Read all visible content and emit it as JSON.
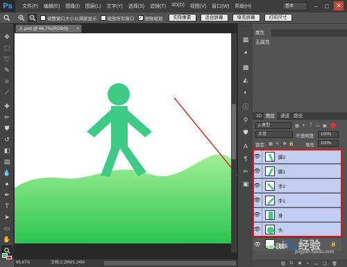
{
  "app": {
    "logo": "Ps"
  },
  "menu": [
    "文件(F)",
    "编辑(E)",
    "图像(I)",
    "图层(L)",
    "文字(Y)",
    "选择(S)",
    "滤镜(T)",
    "3D(D)",
    "视图(V)",
    "窗口(W)",
    "帮助(H)"
  ],
  "workspace": {
    "label": "基本"
  },
  "window_controls": {
    "minimize": "–",
    "maximize": "□",
    "close": "✕"
  },
  "options_bar": {
    "checkbox1_label": "调整窗口大小以满屏显示",
    "checkbox1_checked": false,
    "checkbox2_label": "缩放所有窗口",
    "checkbox2_checked": false,
    "checkbox3_label": "细微缩放",
    "checkbox3_checked": true,
    "buttons": [
      "实际像素",
      "适合屏幕",
      "填充屏幕",
      "打印尺寸"
    ]
  },
  "document": {
    "tab_title": "人.psd @ 66.7%(RGB/8)",
    "tab_close": "×",
    "zoom": "66.67%",
    "doc_info": "文档:2.29M/1.24M"
  },
  "properties": {
    "tab": "属性",
    "content": "无属性"
  },
  "layers_panel": {
    "tabs": [
      "3D",
      "图层",
      "通道",
      "路径"
    ],
    "active_tab": "图层",
    "filter_kind": "ρ 类型",
    "blend_mode": "正常",
    "opacity_label": "不透明度:",
    "opacity_value": "100%",
    "lock_label": "锁定:",
    "fill_label": "填充:",
    "fill_value": "100%",
    "layers": [
      {
        "name": "脚2",
        "visible": true,
        "thumb": "leg"
      },
      {
        "name": "脚1",
        "visible": true,
        "thumb": "leg"
      },
      {
        "name": "手2",
        "visible": true,
        "thumb": "arm"
      },
      {
        "name": "手1",
        "visible": true,
        "thumb": "arm"
      },
      {
        "name": "身",
        "visible": true,
        "thumb": "body"
      },
      {
        "name": "头",
        "visible": true,
        "thumb": "head"
      },
      {
        "name": "背景",
        "visible": true,
        "thumb": "bg"
      }
    ]
  },
  "watermark": {
    "text": "Bai🐾经验",
    "sub": "jingyan.baidu.com"
  },
  "colors": {
    "figure": "#3ecb86",
    "grass_top": "#a2ef95",
    "grass_bottom": "#2cc552",
    "highlight": "#e0151b",
    "selected_layer": "#c3cdf0"
  }
}
